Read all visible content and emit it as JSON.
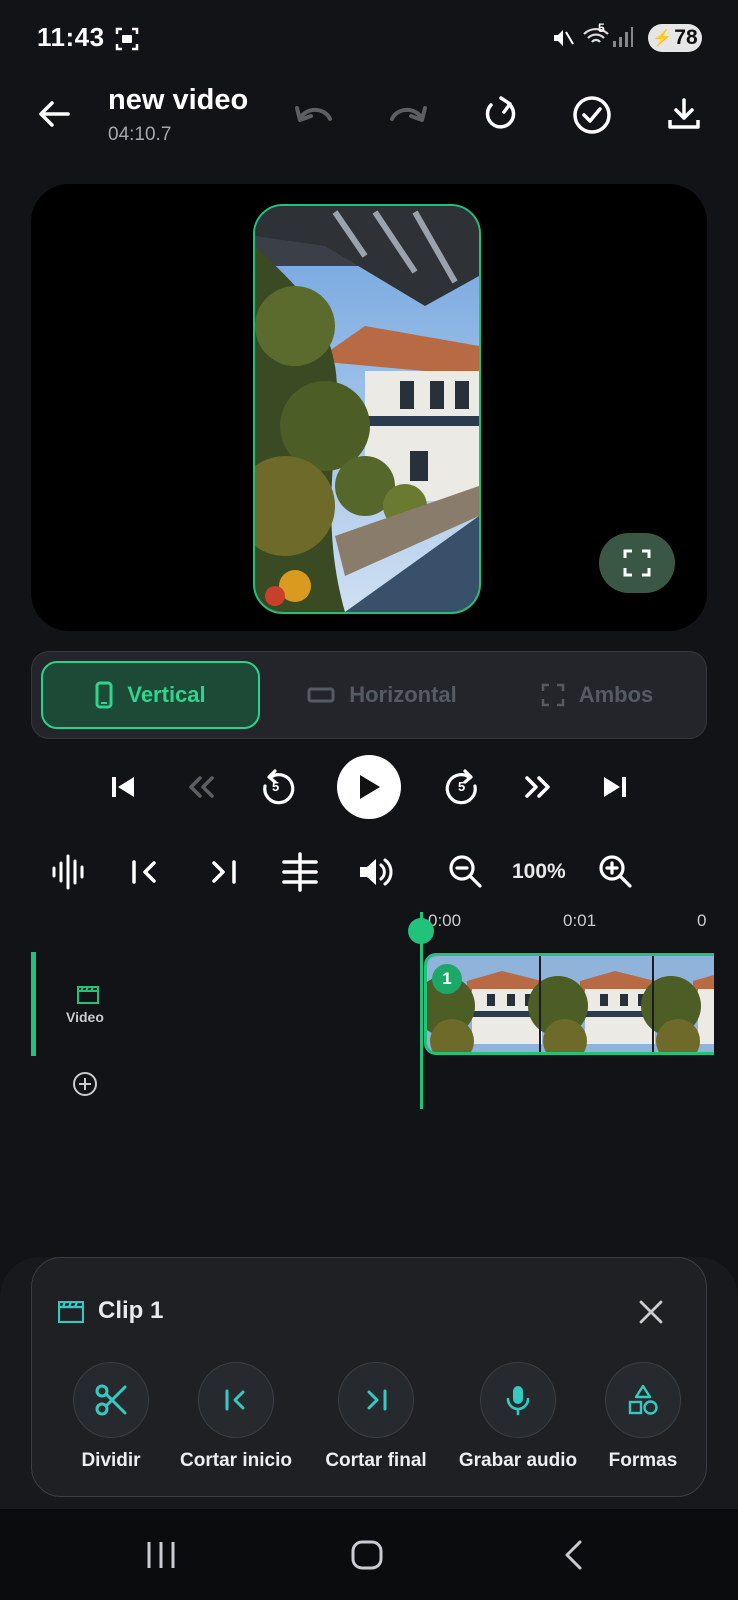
{
  "status": {
    "time": "11:43",
    "battery": "78",
    "signal_label": "5"
  },
  "header": {
    "title": "new video",
    "duration": "04:10.7"
  },
  "orientation": {
    "options": [
      {
        "label": "Vertical",
        "icon": "phone-portrait-icon",
        "active": true
      },
      {
        "label": "Horizontal",
        "icon": "landscape-icon",
        "active": false
      },
      {
        "label": "Ambos",
        "icon": "fullscreen-corners-icon",
        "active": false
      }
    ]
  },
  "transport": {
    "rewind_seconds": "5",
    "forward_seconds": "5"
  },
  "zoom": {
    "level": "100%"
  },
  "timeline": {
    "ruler": [
      "0:00",
      "0:01",
      "0"
    ],
    "track_label": "Video",
    "clip_number": "1"
  },
  "clip_panel": {
    "title": "Clip 1",
    "tools": [
      {
        "label": "Dividir",
        "icon": "scissors-icon"
      },
      {
        "label": "Cortar inicio",
        "icon": "trim-start-icon"
      },
      {
        "label": "Cortar final",
        "icon": "trim-end-icon"
      },
      {
        "label": "Grabar audio",
        "icon": "microphone-icon"
      },
      {
        "label": "Formas",
        "icon": "shapes-icon"
      }
    ]
  },
  "colors": {
    "accent": "#22c27a",
    "accent_text": "#30d48d",
    "tool_icon": "#35c9c0",
    "background": "#121316"
  }
}
